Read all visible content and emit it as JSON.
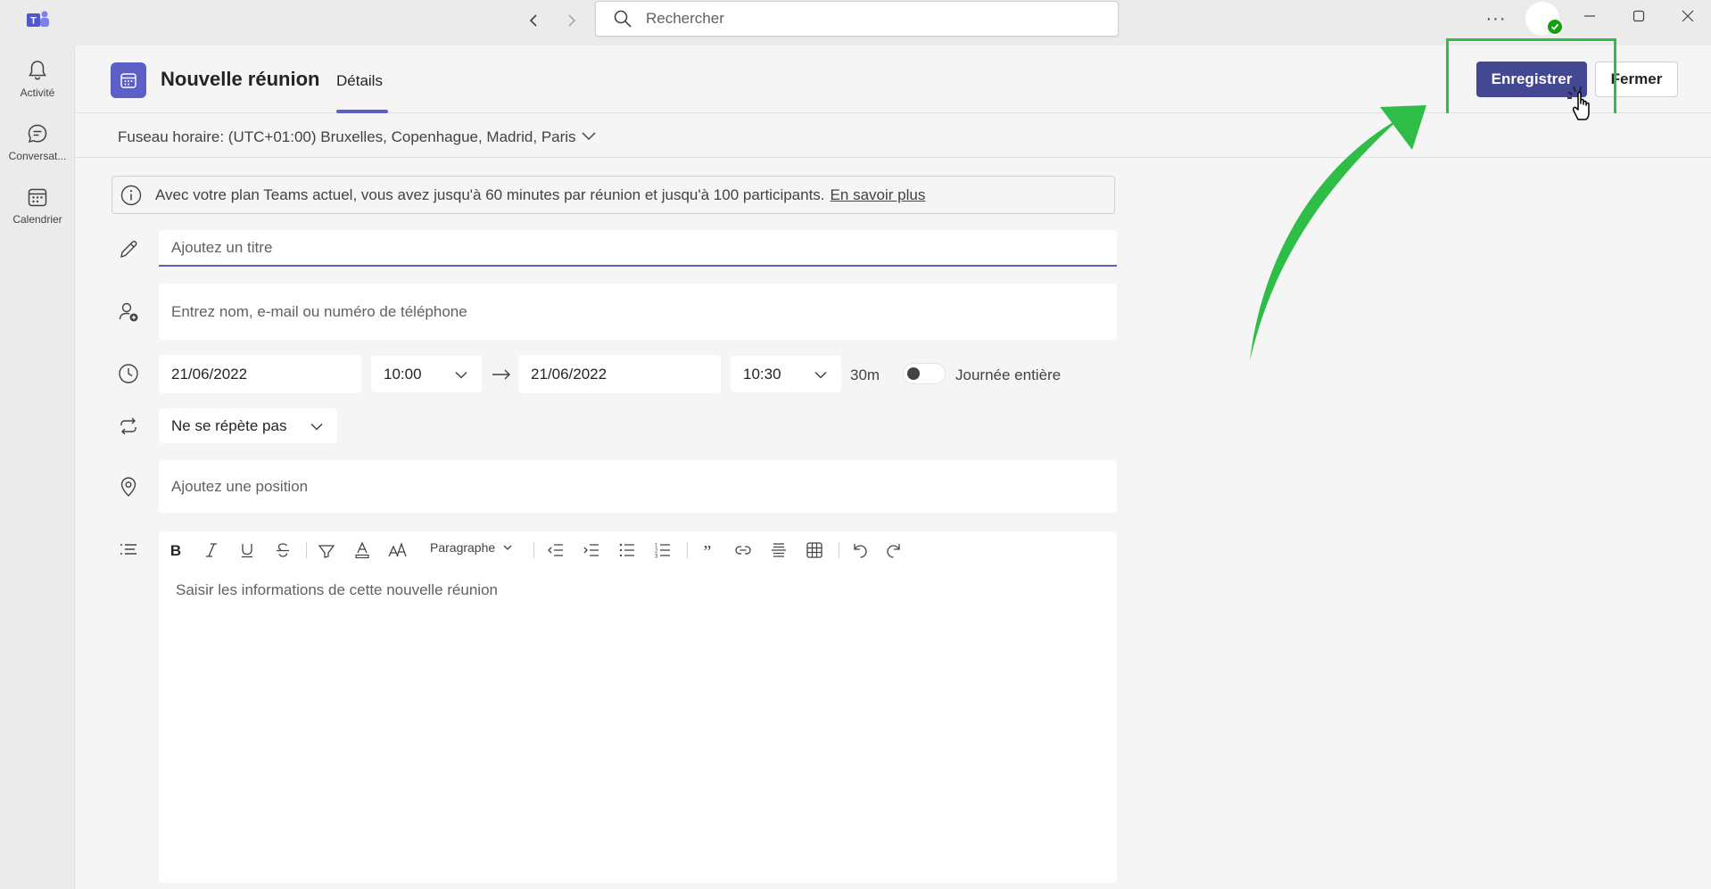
{
  "search": {
    "placeholder": "Rechercher"
  },
  "rail": {
    "items": [
      {
        "label": "Activité",
        "icon": "bell-icon"
      },
      {
        "label": "Conversat...",
        "icon": "chat-icon"
      },
      {
        "label": "Calendrier",
        "icon": "calendar-icon"
      }
    ]
  },
  "header": {
    "title": "Nouvelle réunion",
    "tab": "Détails",
    "save_label": "Enregistrer",
    "close_label": "Fermer"
  },
  "timezone": {
    "label": "Fuseau horaire: (UTC+01:00) Bruxelles, Copenhague, Madrid, Paris"
  },
  "banner": {
    "text": "Avec votre plan Teams actuel, vous avez jusqu'à 60 minutes par réunion et jusqu'à 100 participants.",
    "link": "En savoir plus"
  },
  "form": {
    "title_placeholder": "Ajoutez un titre",
    "attendees_placeholder": "Entrez nom, e-mail ou numéro de téléphone",
    "start_date": "21/06/2022",
    "start_time": "10:00",
    "end_date": "21/06/2022",
    "end_time": "10:30",
    "duration": "30m",
    "all_day_label": "Journée entière",
    "repeat": "Ne se répète pas",
    "location_placeholder": "Ajoutez une position"
  },
  "editor": {
    "paragraph_label": "Paragraphe",
    "placeholder": "Saisir les informations de cette nouvelle réunion"
  },
  "colors": {
    "accent": "#5b5fc7",
    "save_button": "#444791",
    "annotation": "#2ebd46",
    "presence": "#13a10e"
  }
}
